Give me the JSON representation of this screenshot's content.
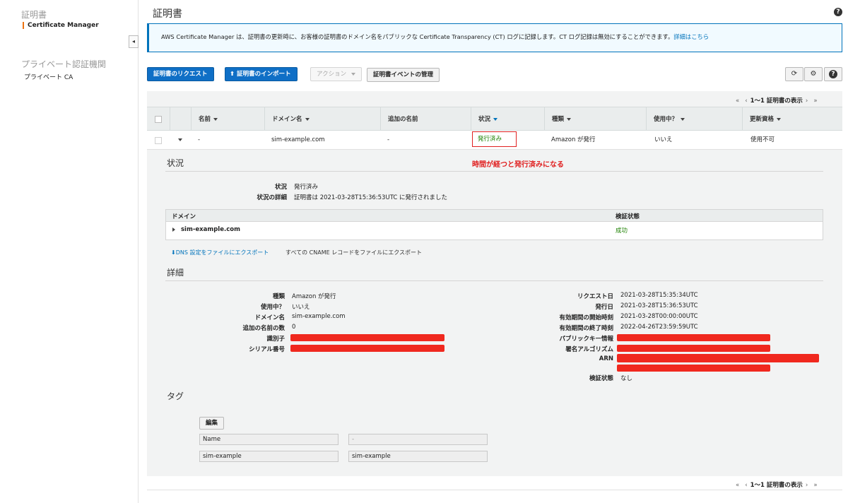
{
  "sidebar": {
    "section1": "証明書",
    "item1": "Certificate Manager",
    "section2": "プライベート認証機関",
    "item2": "プライベート CA",
    "collapse_icon": "◂"
  },
  "header": {
    "title": "証明書",
    "help_icon": "?"
  },
  "banner": {
    "text": "AWS Certificate Manager は、証明書の更新時に、お客様の証明書のドメイン名をパブリックな Certificate Transparency (CT) ログに記録します。CT ログ記録は無効にすることができます。",
    "link": "詳細はこちら"
  },
  "toolbar": {
    "request": "証明書のリクエスト",
    "import": "証明書のインポート",
    "actions": "アクション",
    "events": "証明書イベントの管理"
  },
  "pagination": {
    "first": "«",
    "prev": "‹",
    "label": "1〜1 証明書の表示",
    "next": "›",
    "last": "»"
  },
  "table": {
    "headers": [
      "名前",
      "ドメイン名",
      "追加の名前",
      "状況",
      "種類",
      "使用中？",
      "更新資格"
    ],
    "row": {
      "name": "-",
      "domain": "sim-example.com",
      "additional": "-",
      "status": "発行済み",
      "type": "Amazon が発行",
      "in_use": "いいえ",
      "renewal": "使用不可"
    }
  },
  "annotation": "時間が経つと発行済みになる",
  "status_section": {
    "title": "状況",
    "k_status": "状況",
    "v_status": "発行済み",
    "k_detail": "状況の詳細",
    "v_detail": "証明書は 2021-03-28T15:36:53UTC に発行されました"
  },
  "domain_table": {
    "h_domain": "ドメイン",
    "h_validation": "検証状態",
    "domain": "sim-example.com",
    "validation": "成功"
  },
  "export": {
    "dns": "DNS 設定をファイルにエクスポート",
    "cname": "すべての CNAME レコードをファイルにエクスポート"
  },
  "details": {
    "title": "詳細",
    "left": [
      {
        "k": "種類",
        "v": "Amazon が発行"
      },
      {
        "k": "使用中？",
        "v": "いいえ"
      },
      {
        "k": "ドメイン名",
        "v": "sim-example.com"
      },
      {
        "k": "追加の名前の数",
        "v": "0"
      },
      {
        "k": "識別子",
        "v": ""
      },
      {
        "k": "シリアル番号",
        "v": ""
      }
    ],
    "right": [
      {
        "k": "リクエスト日",
        "v": "2021-03-28T15:35:34UTC"
      },
      {
        "k": "発行日",
        "v": "2021-03-28T15:36:53UTC"
      },
      {
        "k": "有効期間の開始時刻",
        "v": "2021-03-28T00:00:00UTC"
      },
      {
        "k": "有効期間の終了時刻",
        "v": "2022-04-26T23:59:59UTC"
      },
      {
        "k": "パブリックキー情報",
        "v": ""
      },
      {
        "k": "署名アルゴリズム",
        "v": ""
      },
      {
        "k": "ARN",
        "v": ""
      },
      {
        "k": "検証状態",
        "v": "なし"
      }
    ]
  },
  "tags": {
    "title": "タグ",
    "edit": "編集",
    "key_header": "Name",
    "value_header": "-",
    "key": "sim-example",
    "value": "sim-example"
  },
  "colors": {
    "primary_button": "#0f6fc6",
    "success": "#1d8102",
    "annotation": "#e02020",
    "link": "#0073bb"
  }
}
